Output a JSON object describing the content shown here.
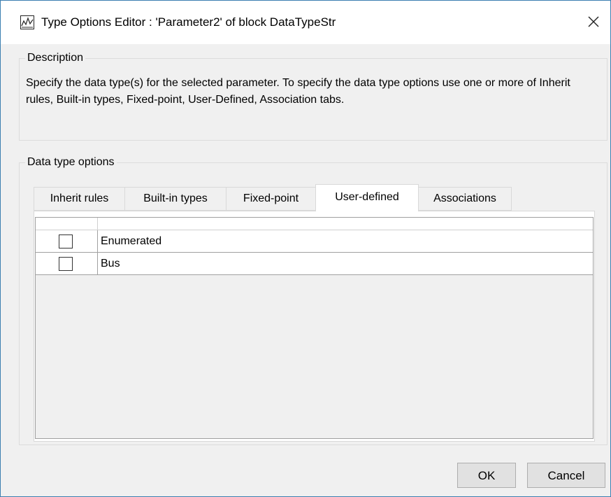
{
  "window": {
    "title": "Type Options Editor : 'Parameter2' of block DataTypeStr"
  },
  "description": {
    "label": "Description",
    "text": "Specify the data type(s) for the selected parameter. To specify the data type options use one or more of Inherit rules, Built-in types, Fixed-point, User-Defined, Association tabs."
  },
  "options": {
    "label": "Data type options",
    "tabs": [
      {
        "label": "Inherit rules",
        "active": false
      },
      {
        "label": "Built-in types",
        "active": false
      },
      {
        "label": "Fixed-point",
        "active": false
      },
      {
        "label": "User-defined",
        "active": true
      },
      {
        "label": "Associations",
        "active": false
      }
    ],
    "rows": [
      {
        "label": "Enumerated",
        "checked": false
      },
      {
        "label": "Bus",
        "checked": false
      }
    ]
  },
  "buttons": {
    "ok": "OK",
    "cancel": "Cancel"
  },
  "colors": {
    "window_border": "#3c7fb1",
    "dialog_bg": "#f0f0f0"
  }
}
